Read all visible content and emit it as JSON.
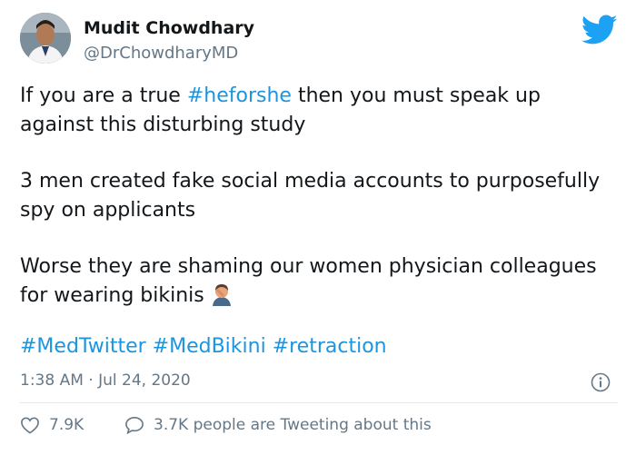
{
  "author": {
    "name": "Mudit Chowdhary",
    "handle": "@DrChowdharyMD"
  },
  "tweet": {
    "line1_pre": "If you are a true ",
    "line1_hashtag": "#heforshe",
    "line1_post": " then you must speak up against this disturbing study",
    "paragraph2": "3 men created fake social media accounts to purposefully spy on applicants",
    "paragraph3": "Worse they are shaming our women physician colleagues for wearing bikinis",
    "hashtags": [
      "#MedTwitter",
      "#MedBikini",
      "#retraction"
    ],
    "timestamp": "1:38 AM · Jul 24, 2020"
  },
  "engagement": {
    "likes": "7.9K",
    "tweeting": "3.7K people are Tweeting about this"
  },
  "icons": {
    "brand": "twitter-bird-icon",
    "emoji": "man-facepalming-icon",
    "info": "info-icon",
    "like": "heart-icon",
    "reply": "speech-bubble-icon"
  },
  "colors": {
    "hashtag": "#1b95e0",
    "twitter_blue": "#1da1f2",
    "muted": "#657786"
  }
}
